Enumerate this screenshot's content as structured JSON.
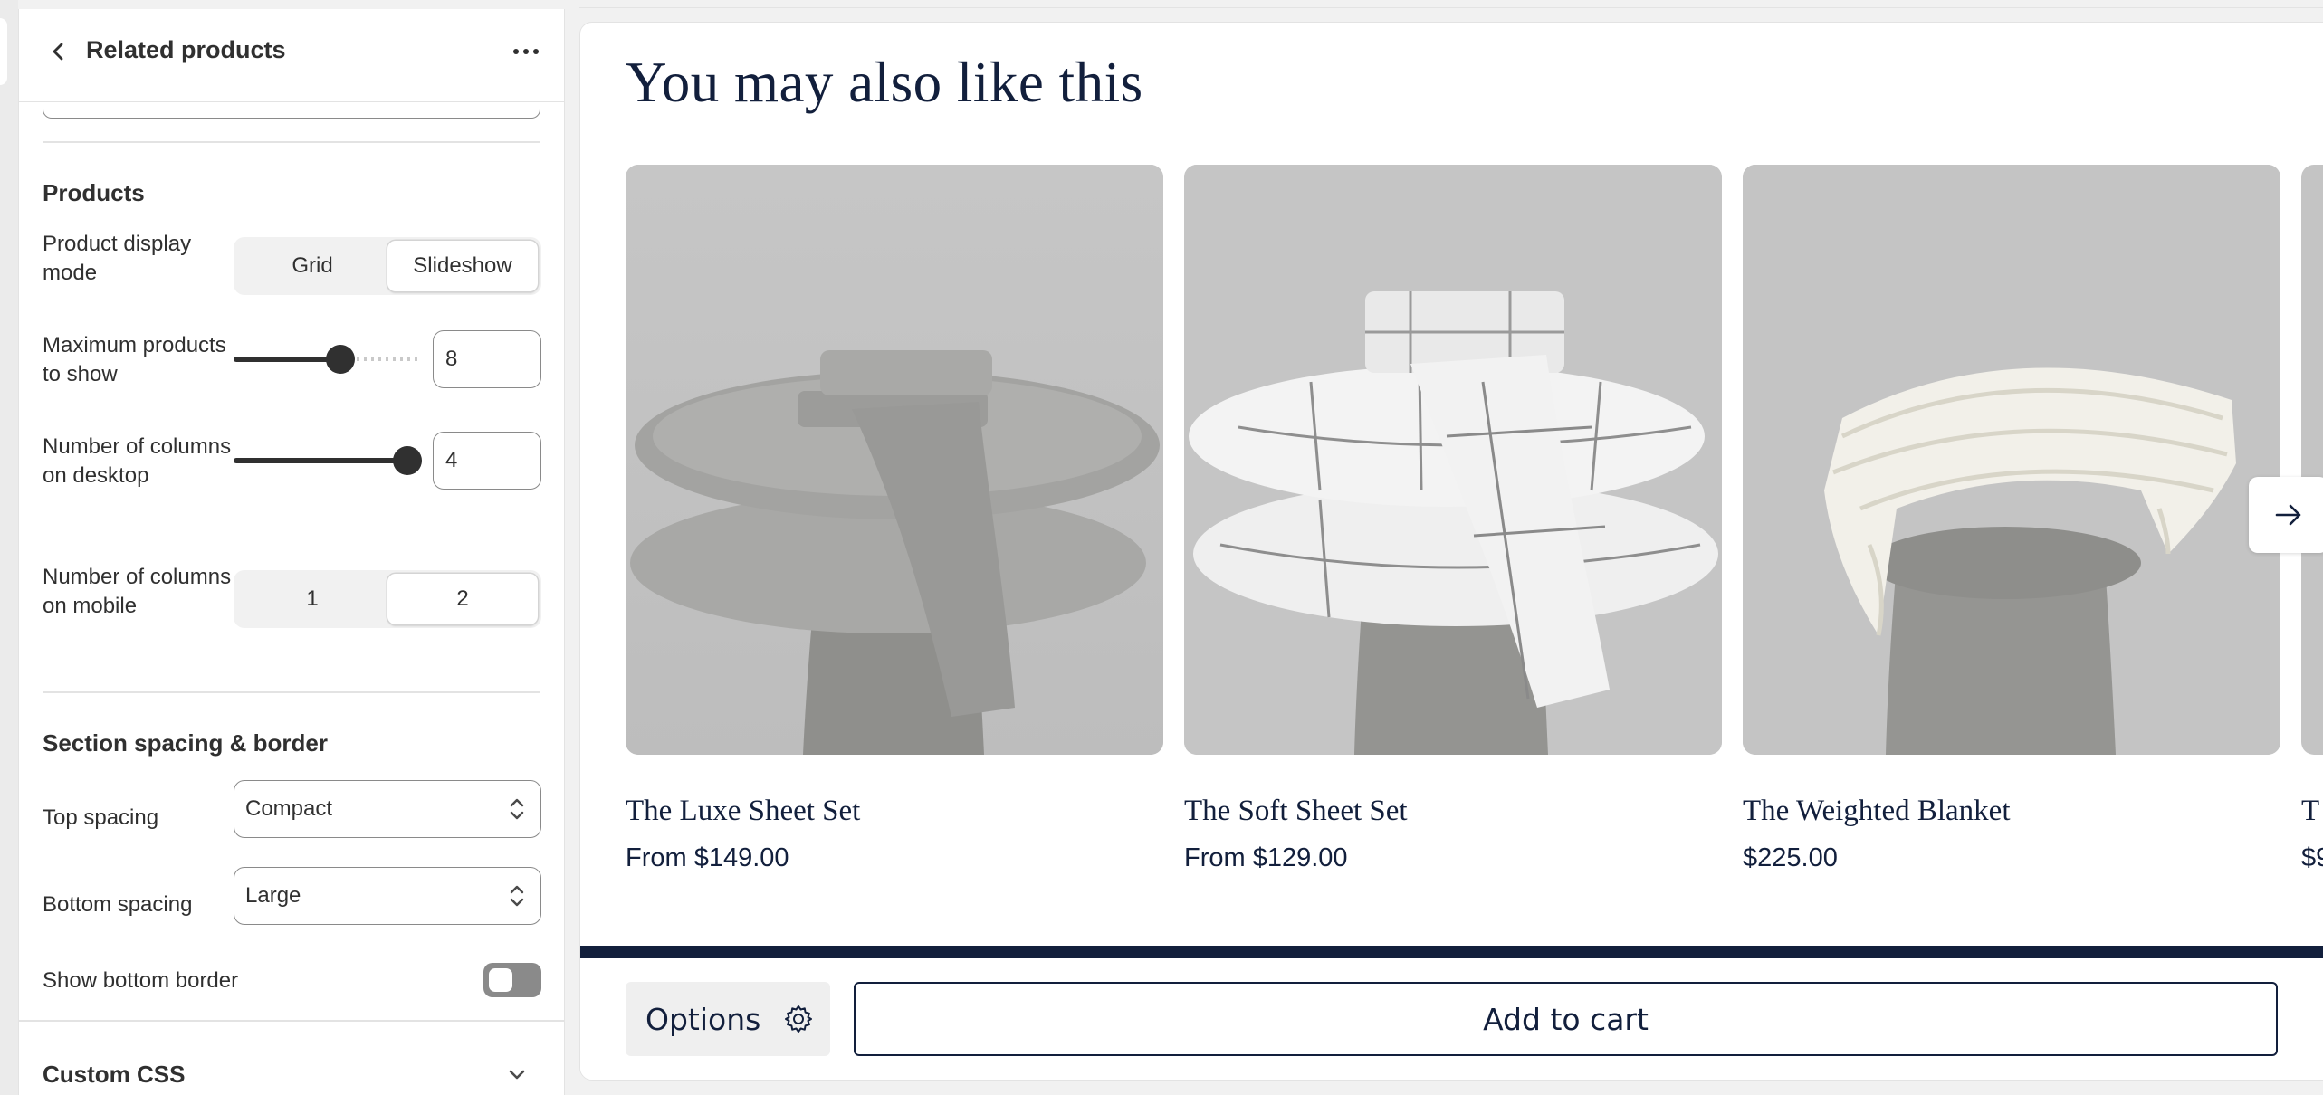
{
  "panel": {
    "title": "Related products",
    "products_section": {
      "title": "Products",
      "display_mode": {
        "label": "Product display mode",
        "options": [
          "Grid",
          "Slideshow"
        ],
        "selected": "Slideshow"
      },
      "max_products": {
        "label": "Maximum products to show",
        "value": "8",
        "slider_fraction": 0.58
      },
      "columns_desktop": {
        "label": "Number of columns on desktop",
        "value": "4",
        "slider_fraction": 1.0
      },
      "columns_mobile": {
        "label": "Number of columns on mobile",
        "options": [
          "1",
          "2"
        ],
        "selected": "2"
      }
    },
    "spacing_section": {
      "title": "Section spacing & border",
      "top_spacing": {
        "label": "Top spacing",
        "value": "Compact"
      },
      "bottom_spacing": {
        "label": "Bottom spacing",
        "value": "Large"
      },
      "bottom_border": {
        "label": "Show bottom border",
        "enabled": false
      }
    },
    "custom_css": {
      "title": "Custom CSS"
    }
  },
  "preview": {
    "heading": "You may also like this",
    "products": [
      {
        "name": "The Luxe Sheet Set",
        "price": "From $149.00"
      },
      {
        "name": "The Soft Sheet Set",
        "price": "From $129.00"
      },
      {
        "name": "The Weighted Blanket",
        "price": "$225.00"
      },
      {
        "name": "T",
        "price": "$9"
      }
    ],
    "sticky_bar": {
      "options_label": "Options",
      "add_to_cart_label": "Add to cart"
    }
  },
  "colors": {
    "brand_navy": "#121f3c",
    "image_bg": "#c4c4c4",
    "panel_text": "#303030"
  },
  "icons": [
    "chevron-left-icon",
    "more-horizontal-icon",
    "select-chevron-icon",
    "chevron-down-icon",
    "arrow-right-icon",
    "gear-icon"
  ]
}
